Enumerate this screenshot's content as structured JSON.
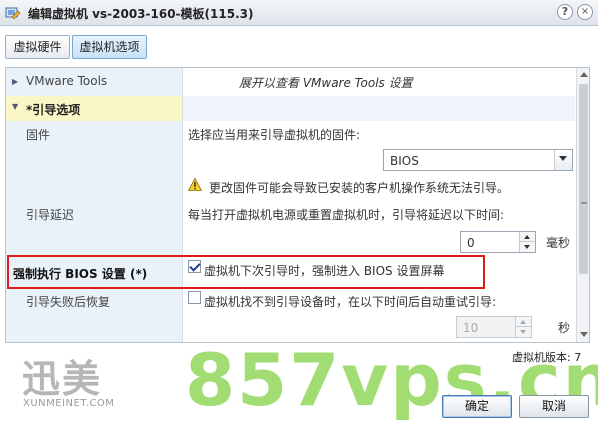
{
  "window": {
    "title": "编辑虚拟机 vs-2003-160-模板(115.3)",
    "help_label": "?",
    "close_label": "×"
  },
  "tabs": [
    {
      "label": "虚拟硬件"
    },
    {
      "label": "虚拟机选项",
      "selected": true
    }
  ],
  "rows": {
    "vmware_tools": {
      "label": "VMware Tools",
      "value": "展开以查看 VMware Tools 设置"
    },
    "boot_options": {
      "label": "*引导选项"
    },
    "firmware": {
      "label": "固件",
      "prompt": "选择应当用来引导虚拟机的固件:",
      "selected": "BIOS",
      "warning": "更改固件可能会导致已安装的客户机操作系统无法引导。"
    },
    "boot_delay": {
      "label": "引导延迟",
      "prompt": "每当打开虚拟机电源或重置虚拟机时，引导将延迟以下时间:",
      "value": "0",
      "unit": "毫秒"
    },
    "force_bios": {
      "label": "强制执行 BIOS 设置 (*)",
      "checkbox_label": "虚拟机下次引导时，强制进入 BIOS 设置屏幕",
      "checked": true
    },
    "boot_failure": {
      "label": "引导失败后恢复",
      "checkbox_label": "虚拟机找不到引导设备时，在以下时间后自动重试引导:",
      "checked": false,
      "value": "10",
      "unit": "秒"
    }
  },
  "footer": {
    "version": "虚拟机版本: 7",
    "ok_label": "确定",
    "cancel_label": "取消"
  },
  "watermarks": {
    "logo_text": "迅美",
    "logo_url": "XUNMEINET.COM",
    "site_text": "857vps.cn"
  },
  "colors": {
    "highlight_border": "#e01a1a",
    "section_header": "#fbf6c5",
    "label_column": "#e9f2f9"
  }
}
